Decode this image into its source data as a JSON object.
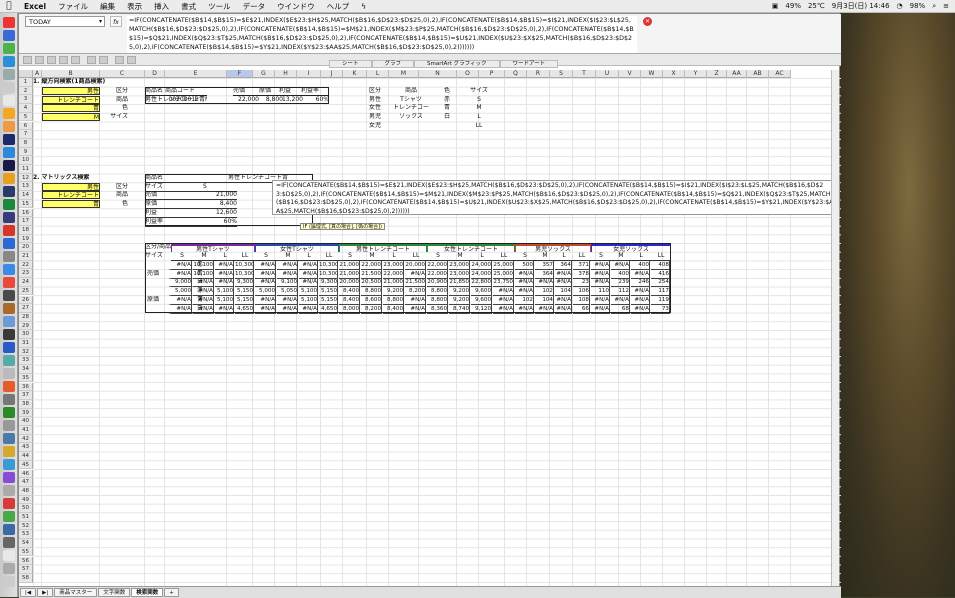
{
  "menubar": {
    "app": "Excel",
    "items": [
      "ファイル",
      "編集",
      "表示",
      "挿入",
      "書式",
      "ツール",
      "データ",
      "ウインドウ",
      "ヘルプ"
    ],
    "status": [
      "49%",
      "25℃",
      "9月3日(日) 14:46",
      "98%"
    ]
  },
  "formula": {
    "namebox": "TODAY",
    "fx": "fx",
    "text": "=IF(CONCATENATE($B$14,$B$15)=$E$21,INDEX($E$23:$H$25,MATCH($B$16,$D$23:$D$25,0),2),IF(CONCATENATE($B$14,$B$15)=$I$21,INDEX($I$23:$L$25,MATCH($B$16,$D$23:$D$25,0),2),IF(CONCATENATE($B$14,$B$15)=$M$21,INDEX($M$23:$P$25,MATCH($B$16,$D$23:$D$25,0),2),IF(CONCATENATE($B$14,$B$15)=$Q$21,INDEX($Q$23:$T$25,MATCH($B$16,$D$23:$D$25,0),2),IF(CONCATENATE($B$14,$B$15)=$U$21,INDEX($U$23:$X$25,MATCH($B$16,$D$23:$D$25,0),2),IF(CONCATENATE($B$14,$B$15)=$Y$21,INDEX($Y$23:$AA$25,MATCH($B$16,$D$23:$D$25,0),2)))))))"
  },
  "ribbon": [
    "シート",
    "グラフ",
    "SmartArt グラフィック",
    "ワードアート"
  ],
  "columns": [
    "A",
    "B",
    "C",
    "D",
    "E",
    "F",
    "G",
    "H",
    "I",
    "J",
    "K",
    "L",
    "M",
    "N",
    "O",
    "P",
    "Q",
    "R",
    "S",
    "T",
    "U",
    "V",
    "W",
    "X",
    "Y",
    "Z",
    "AA",
    "AB",
    "AC"
  ],
  "rows": [
    "1",
    "2",
    "3",
    "4",
    "5",
    "6",
    "7",
    "8",
    "9",
    "10",
    "11",
    "12",
    "13",
    "14",
    "15",
    "16",
    "17",
    "18",
    "19",
    "20",
    "21",
    "22",
    "23",
    "24",
    "25",
    "26",
    "27",
    "28",
    "29",
    "30",
    "31",
    "32",
    "33",
    "34",
    "35",
    "36",
    "37",
    "38",
    "39",
    "40",
    "41",
    "42",
    "43",
    "44",
    "45",
    "46",
    "47",
    "48",
    "49",
    "50",
    "51",
    "52",
    "53",
    "54",
    "55",
    "56",
    "57",
    "58"
  ],
  "sec1": {
    "title": "1. 縦方向検索(1商品検索)",
    "labels": [
      "区分",
      "商品",
      "色",
      "サイズ"
    ],
    "values": [
      "男性",
      "トレンチコート",
      "青",
      "M"
    ],
    "table_headers": [
      "商品名",
      "商品コード",
      "売価",
      "原価",
      "利益",
      "利益率"
    ],
    "table_row": [
      "男性トレンチコート青M",
      "00200012",
      "22,000",
      "8,800",
      "13,200",
      "60%"
    ],
    "lookup_headers": [
      "区分",
      "商品",
      "色",
      "サイズ"
    ],
    "lookup_col1": [
      "男性",
      "女性",
      "男児",
      "女児"
    ],
    "lookup_col2": [
      "Tシャツ",
      "トレンチコート",
      "ソックス"
    ],
    "lookup_col3": [
      "赤",
      "青",
      "白"
    ],
    "lookup_col4": [
      "S",
      "M",
      "L",
      "LL"
    ]
  },
  "sec2": {
    "title": "2. マトリックス検索",
    "labels": [
      "区分",
      "商品",
      "色"
    ],
    "values": [
      "男性",
      "トレンチコート",
      "青"
    ],
    "info_labels": [
      "商品名",
      "サイズ",
      "売価",
      "原価",
      "利益",
      "利益率"
    ],
    "info_values": [
      "男性トレンチコート青",
      "S",
      "21,000",
      "8,400",
      "12,600",
      "60%"
    ],
    "overlay": "=IF(CONCATENATE($B$14,$B$15)=$E$21,INDEX($E$23:$H$25,MATCH($B$16,$D$23:$D$25,0),2),IF(CONCATENATE($B$14,$B$15)=$I$21,INDEX($I$23:$L$25,MATCH($B$16,$D$23:$D$25,0),2),IF(CONCATENATE($B$14,$B$15)=$M$21,INDEX($M$23:$P$25,MATCH($B$16,$D$23:$D$25,0),2),IF(CONCATENATE($B$14,$B$15)=$Q$21,INDEX($Q$23:$T$25,MATCH($B$16,$D$23:$D$25,0),2),IF(CONCATENATE($B$14,$B$15)=$U$21,INDEX($U$23:$X$25,MATCH($B$16,$D$23:$D$25,0),2),IF(CONCATENATE($B$14,$B$15)=$Y$21,INDEX($Y$23:$AA$25,MATCH($B$16,$D$23:$D$25,0),2))))))",
    "tooltip": "IF (論理式, [真の場合], [偽の場合])"
  },
  "matrix": {
    "corner1": "区分/商品",
    "corner2": "サイズ",
    "groups": [
      "男性Tシャツ",
      "女性Tシャツ",
      "男性トレンチコート",
      "女性トレンチコート",
      "男児ソックス",
      "女児ソックス"
    ],
    "sizes": [
      "S",
      "M",
      "L",
      "LL"
    ],
    "sizes3": [
      "S",
      "M",
      "L"
    ],
    "sec_labels": [
      "売価",
      "原価"
    ],
    "colors": [
      "赤",
      "青",
      "白"
    ],
    "sell": [
      [
        "#N/A",
        "10,100",
        "#N/A",
        "10,300",
        "#N/A",
        "#N/A",
        "#N/A",
        "10,300",
        "21,000",
        "22,000",
        "23,000",
        "20,000",
        "22,000",
        "23,000",
        "24,000",
        "25,000",
        "500",
        "357",
        "364",
        "371",
        "#N/A",
        "#N/A",
        "400",
        "408"
      ],
      [
        "#N/A",
        "10,100",
        "#N/A",
        "10,300",
        "#N/A",
        "#N/A",
        "#N/A",
        "10,300",
        "21,000",
        "21,500",
        "22,000",
        "#N/A",
        "22,000",
        "23,000",
        "24,000",
        "25,000",
        "#N/A",
        "364",
        "#N/A",
        "378",
        "#N/A",
        "400",
        "#N/A",
        "416"
      ],
      [
        "9,000",
        "#N/A",
        "#N/A",
        "9,300",
        "#N/A",
        "9,100",
        "#N/A",
        "9,300",
        "20,000",
        "20,500",
        "21,000",
        "21,500",
        "20,900",
        "21,850",
        "22,800",
        "23,750",
        "#N/A",
        "#N/A",
        "#N/A",
        "23",
        "#N/A",
        "239",
        "246",
        "254"
      ]
    ],
    "cost": [
      [
        "5,000",
        "#N/A",
        "5,100",
        "5,150",
        "5,000",
        "5,050",
        "5,100",
        "5,150",
        "8,400",
        "8,800",
        "9,200",
        "8,200",
        "8,800",
        "9,200",
        "9,600",
        "#N/A",
        "#N/A",
        "102",
        "104",
        "106",
        "110",
        "112",
        "#N/A",
        "117"
      ],
      [
        "#N/A",
        "#N/A",
        "5,100",
        "5,150",
        "#N/A",
        "#N/A",
        "5,100",
        "5,150",
        "8,400",
        "8,600",
        "8,800",
        "#N/A",
        "8,800",
        "9,200",
        "9,600",
        "#N/A",
        "102",
        "104",
        "#N/A",
        "108",
        "#N/A",
        "#N/A",
        "#N/A",
        "119"
      ],
      [
        "#N/A",
        "#N/A",
        "#N/A",
        "4,650",
        "#N/A",
        "#N/A",
        "#N/A",
        "4,650",
        "8,000",
        "8,200",
        "8,400",
        "#N/A",
        "8,360",
        "8,740",
        "9,120",
        "#N/A",
        "#N/A",
        "#N/A",
        "#N/A",
        "66",
        "#N/A",
        "68",
        "#N/A",
        "73"
      ]
    ],
    "group_colors": [
      "#7a2a9a",
      "#2a4ab0",
      "#2a8a3a",
      "#2a8a3a",
      "#c04a2a",
      "#2a2ad0"
    ]
  },
  "sheets": [
    "商品マスター",
    "文字関数",
    "検索関数",
    "+"
  ]
}
